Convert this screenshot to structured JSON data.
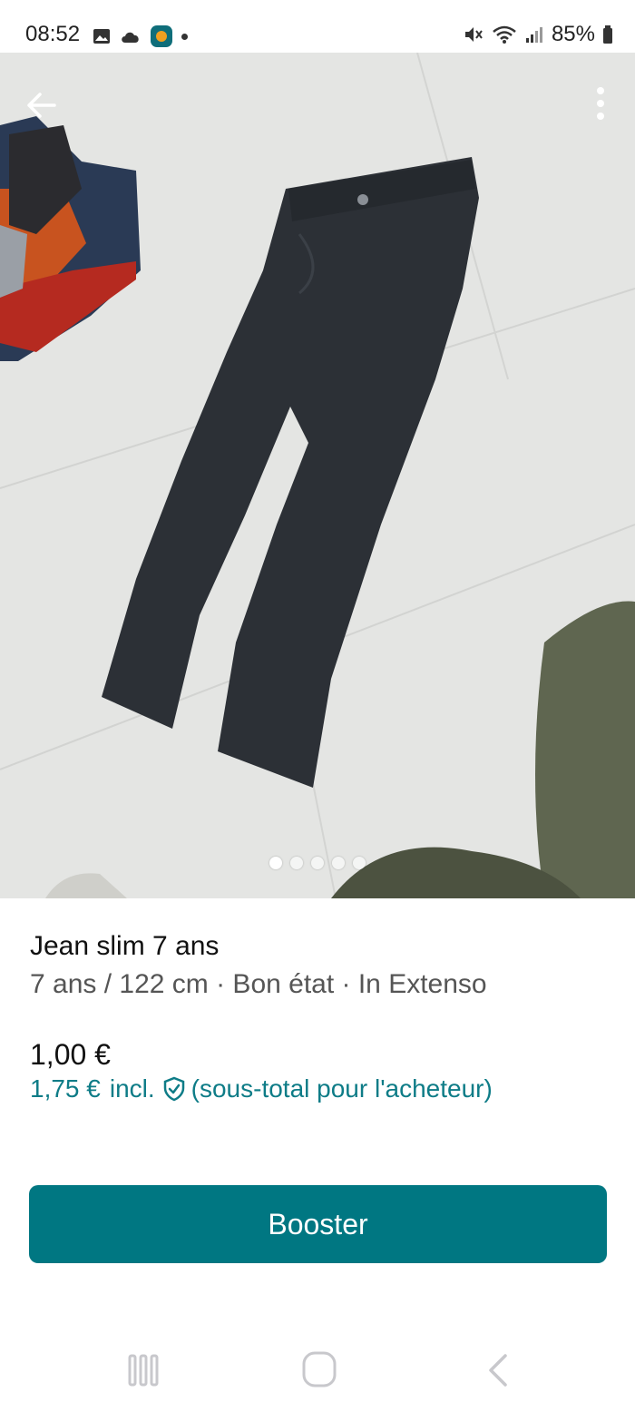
{
  "status_bar": {
    "time": "08:52",
    "battery": "85%",
    "left_icons": [
      "gallery-icon",
      "cloud-icon",
      "app-icon"
    ],
    "right_icons": [
      "mute-icon",
      "wifi-icon",
      "signal-icon",
      "battery-icon"
    ]
  },
  "gallery": {
    "image_count": 5,
    "active_index": 0
  },
  "item": {
    "title": "Jean slim 7 ans",
    "subtitle": "7 ans / 122 cm · Bon état · In Extenso",
    "price": "1,00 €",
    "price_incl": "1,75 €",
    "incl_label": "incl.",
    "buyer_note": "(sous-total pour l'acheteur)"
  },
  "actions": {
    "booster_label": "Booster"
  },
  "colors": {
    "accent": "#007782",
    "price_incl": "#0e7c87"
  }
}
